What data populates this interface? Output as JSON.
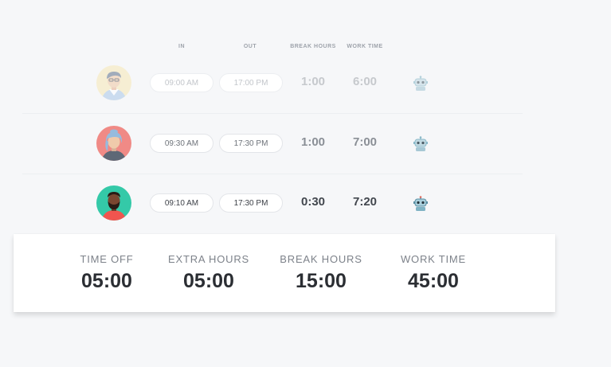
{
  "columns": {
    "in": "IN",
    "out": "OUT",
    "break_hours": "BREAK HOURS",
    "work_time": "WORK TIME"
  },
  "rows": [
    {
      "avatar": "avatar-man-glasses-yellow",
      "in": "09:00 AM",
      "out": "17:00 PM",
      "break": "1:00",
      "work": "6:00",
      "icon": "robot-icon",
      "state": "faded"
    },
    {
      "avatar": "avatar-woman-blue-hair-red",
      "in": "09:30 AM",
      "out": "17:30 PM",
      "break": "1:00",
      "work": "7:00",
      "icon": "robot-icon",
      "state": "mid"
    },
    {
      "avatar": "avatar-man-beard-green",
      "in": "09:10 AM",
      "out": "17:30 PM",
      "break": "0:30",
      "work": "7:20",
      "icon": "robot-icon",
      "state": "active"
    }
  ],
  "summary": {
    "time_off": {
      "label": "TIME OFF",
      "value": "05:00"
    },
    "extra_hours": {
      "label": "EXTRA HOURS",
      "value": "05:00"
    },
    "break_hours": {
      "label": "BREAK HOURS",
      "value": "15:00"
    },
    "work_time": {
      "label": "WORK TIME",
      "value": "45:00"
    }
  },
  "colors": {
    "background": "#f6f7f9",
    "avatar1_bg": "#f7e8b5",
    "avatar2_bg": "#f07f7a",
    "avatar3_bg": "#34c9a8",
    "robot": "#7fb3c4"
  }
}
